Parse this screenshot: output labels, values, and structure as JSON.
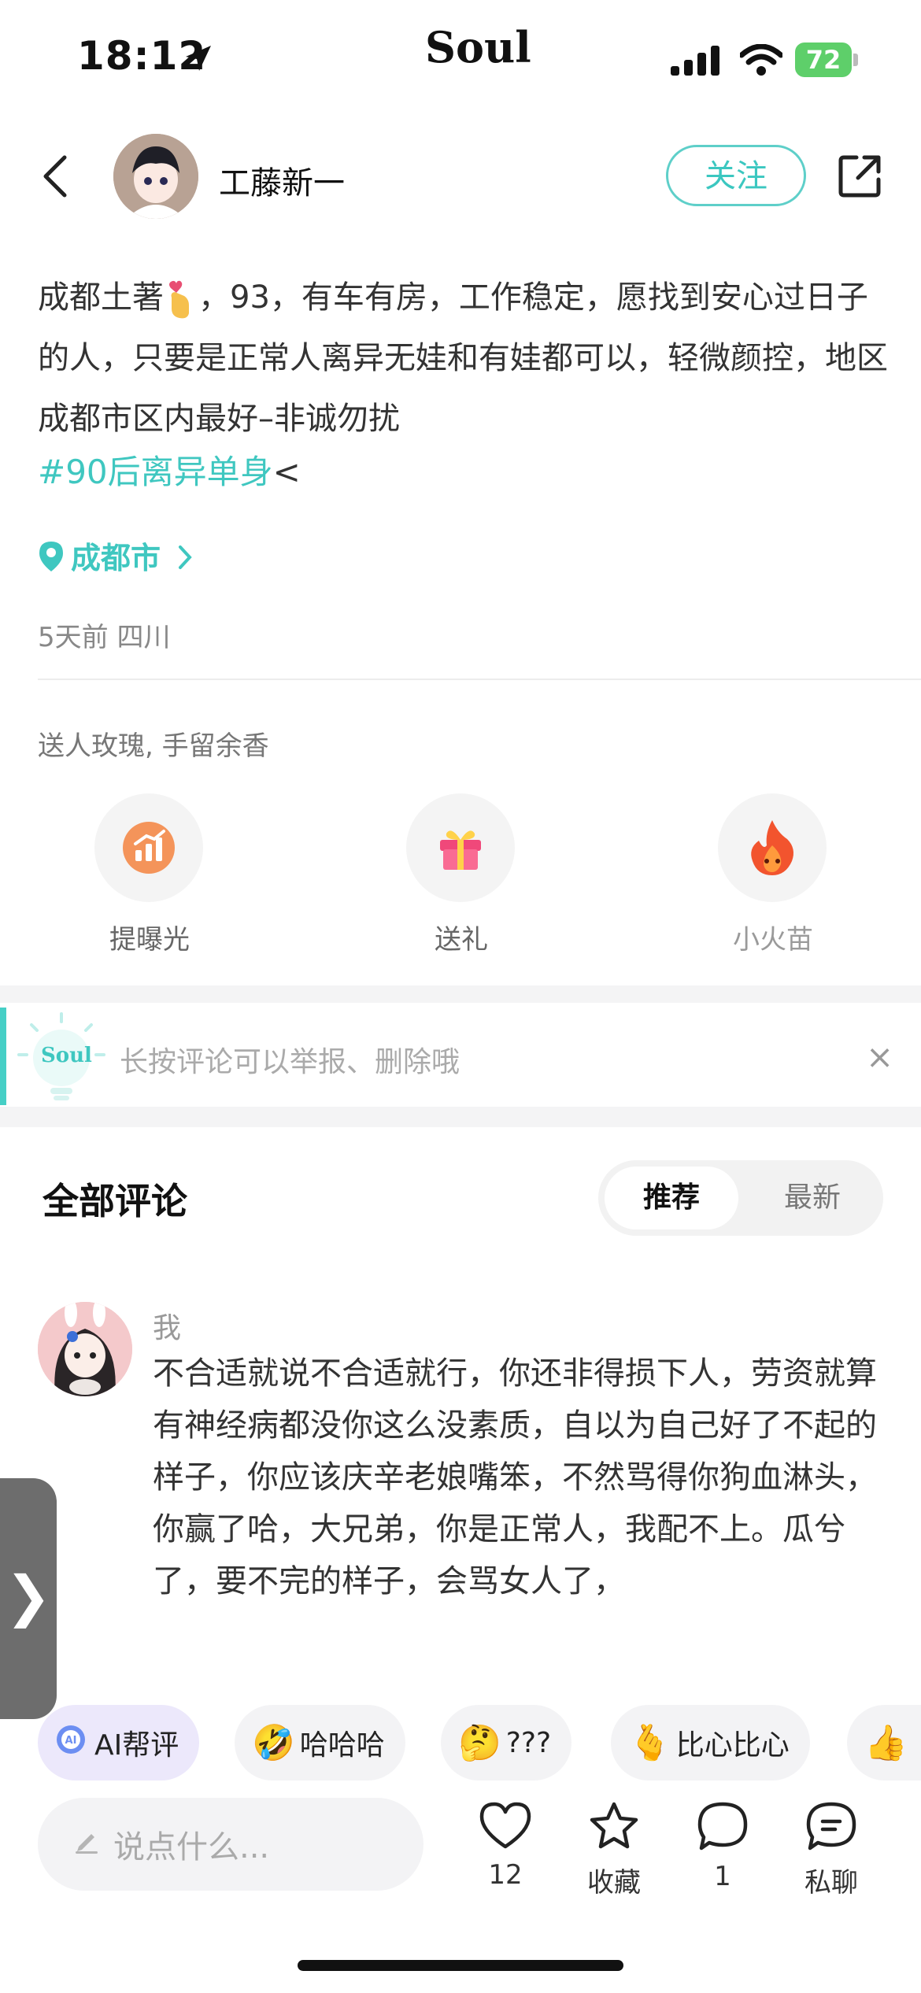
{
  "status_bar": {
    "time": "18:12",
    "app_logo": "Soul",
    "battery": "72"
  },
  "header": {
    "username": "工藤新一",
    "follow_label": "关注"
  },
  "post": {
    "text_before_emoji": "成都土著",
    "text_after_emoji": "，93，有车有房，工作稳定，愿找到安心过日子的人，只要是正常人离异无娃和有娃都可以，轻微颜控，地区成都市区内最好–非诚勿扰",
    "hashtag": "#90后离异单身",
    "hashtag_tail": "<",
    "location": "成都市",
    "meta": "5天前 四川"
  },
  "gift_section": {
    "hint": "送人玫瑰, 手留余香",
    "actions": [
      {
        "label": "提曝光",
        "icon": "boost-icon"
      },
      {
        "label": "送礼",
        "icon": "gift-icon"
      },
      {
        "label": "小火苗",
        "icon": "flame-icon"
      }
    ]
  },
  "tip": {
    "logo": "Soul",
    "text": "长按评论可以举报、删除哦",
    "close": "×"
  },
  "comments": {
    "title": "全部评论",
    "sort": [
      "推荐",
      "最新"
    ],
    "active_sort": "推荐",
    "items": [
      {
        "author": "我",
        "text": "不合适就说不合适就行，你还非得损下人，劳资就算有神经病都没你这么没素质，自以为自己好了不起的样子，你应该庆辛老娘嘴笨，不然骂得你狗血淋头，你赢了哈，大兄弟，你是正常人，我配不上。瓜兮了，要不完的样子，会骂女人了，"
      }
    ]
  },
  "side_tab": "❯",
  "quick_reactions": [
    {
      "emoji": "",
      "label": "AI帮评"
    },
    {
      "emoji": "🤣",
      "label": "哈哈哈"
    },
    {
      "emoji": "🤔",
      "label": "???"
    },
    {
      "emoji": "🫰",
      "label": "比心比心"
    },
    {
      "emoji": "👍",
      "label": ""
    }
  ],
  "bottom_bar": {
    "input_placeholder": "说点什么...",
    "like_count": "12",
    "favorite_label": "收藏",
    "comment_count": "1",
    "chat_label": "私聊"
  },
  "colors": {
    "accent": "#3fc7c0",
    "side_tab": "#6d6d6d",
    "battery": "#5ecf6a"
  }
}
